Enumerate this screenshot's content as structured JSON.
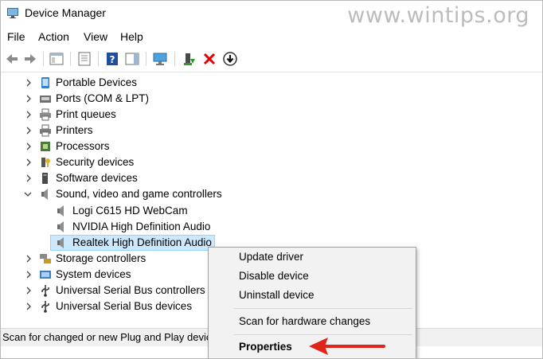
{
  "window": {
    "title": "Device Manager",
    "watermark": "www.wintips.org"
  },
  "menu": [
    "File",
    "Action",
    "View",
    "Help"
  ],
  "tree": [
    {
      "label": "Portable Devices",
      "icon": "portable-device-icon",
      "state": "collapsed"
    },
    {
      "label": "Ports (COM & LPT)",
      "icon": "port-icon",
      "state": "collapsed"
    },
    {
      "label": "Print queues",
      "icon": "print-queue-icon",
      "state": "collapsed"
    },
    {
      "label": "Printers",
      "icon": "printer-icon",
      "state": "collapsed"
    },
    {
      "label": "Processors",
      "icon": "processor-icon",
      "state": "collapsed"
    },
    {
      "label": "Security devices",
      "icon": "security-device-icon",
      "state": "collapsed"
    },
    {
      "label": "Software devices",
      "icon": "software-device-icon",
      "state": "collapsed"
    },
    {
      "label": "Sound, video and game controllers",
      "icon": "speaker-icon",
      "state": "expanded"
    },
    {
      "label": "Logi C615 HD WebCam",
      "icon": "speaker-icon",
      "state": "child"
    },
    {
      "label": "NVIDIA High Definition Audio",
      "icon": "speaker-icon",
      "state": "child"
    },
    {
      "label": "Realtek High Definition Audio",
      "icon": "speaker-icon",
      "state": "selected"
    },
    {
      "label": "Storage controllers",
      "icon": "storage-controller-icon",
      "state": "collapsed"
    },
    {
      "label": "System devices",
      "icon": "system-device-icon",
      "state": "collapsed"
    },
    {
      "label": "Universal Serial Bus controllers",
      "icon": "usb-icon",
      "state": "collapsed"
    },
    {
      "label": "Universal Serial Bus devices",
      "icon": "usb-icon",
      "state": "collapsed"
    }
  ],
  "status": "Scan for changed or new Plug and Play devic",
  "context_menu": {
    "items": [
      "Update driver",
      "Disable device",
      "Uninstall device",
      "Scan for hardware changes",
      "Properties"
    ]
  },
  "colors": {
    "accent_arrow": "#e2231a",
    "selection": "#cce8ff"
  }
}
